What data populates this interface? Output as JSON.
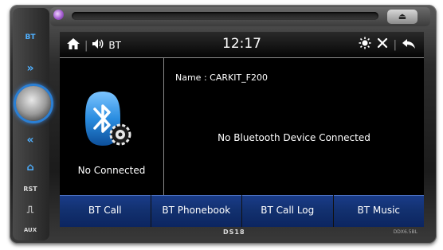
{
  "status_bar": {
    "source_label": "BT",
    "time": "12:17"
  },
  "left_panel": {
    "connection_status": "No Connected"
  },
  "device": {
    "name_label": "Name : CARKIT_F200",
    "message": "No Bluetooth Device Connected"
  },
  "tabs": [
    {
      "label": "BT Call"
    },
    {
      "label": "BT Phonebook"
    },
    {
      "label": "BT Call Log"
    },
    {
      "label": "BT Music"
    }
  ],
  "side_buttons": {
    "bt": "BT",
    "next": "»",
    "prev": "«",
    "home": "⌂",
    "rst": "RST",
    "usb": "⎍",
    "aux": "AUX"
  },
  "footer": {
    "brand": "DS18",
    "model": "DDX6.5BL"
  },
  "icons": {
    "home": "home-icon",
    "volume": "volume-icon",
    "brightness": "brightness-icon",
    "settings": "settings-icon",
    "back": "back-icon"
  },
  "colors": {
    "tab_blue": "#12306e",
    "bluetooth_blue": "#2a8de0",
    "knob_glow": "#2a7fd4"
  }
}
